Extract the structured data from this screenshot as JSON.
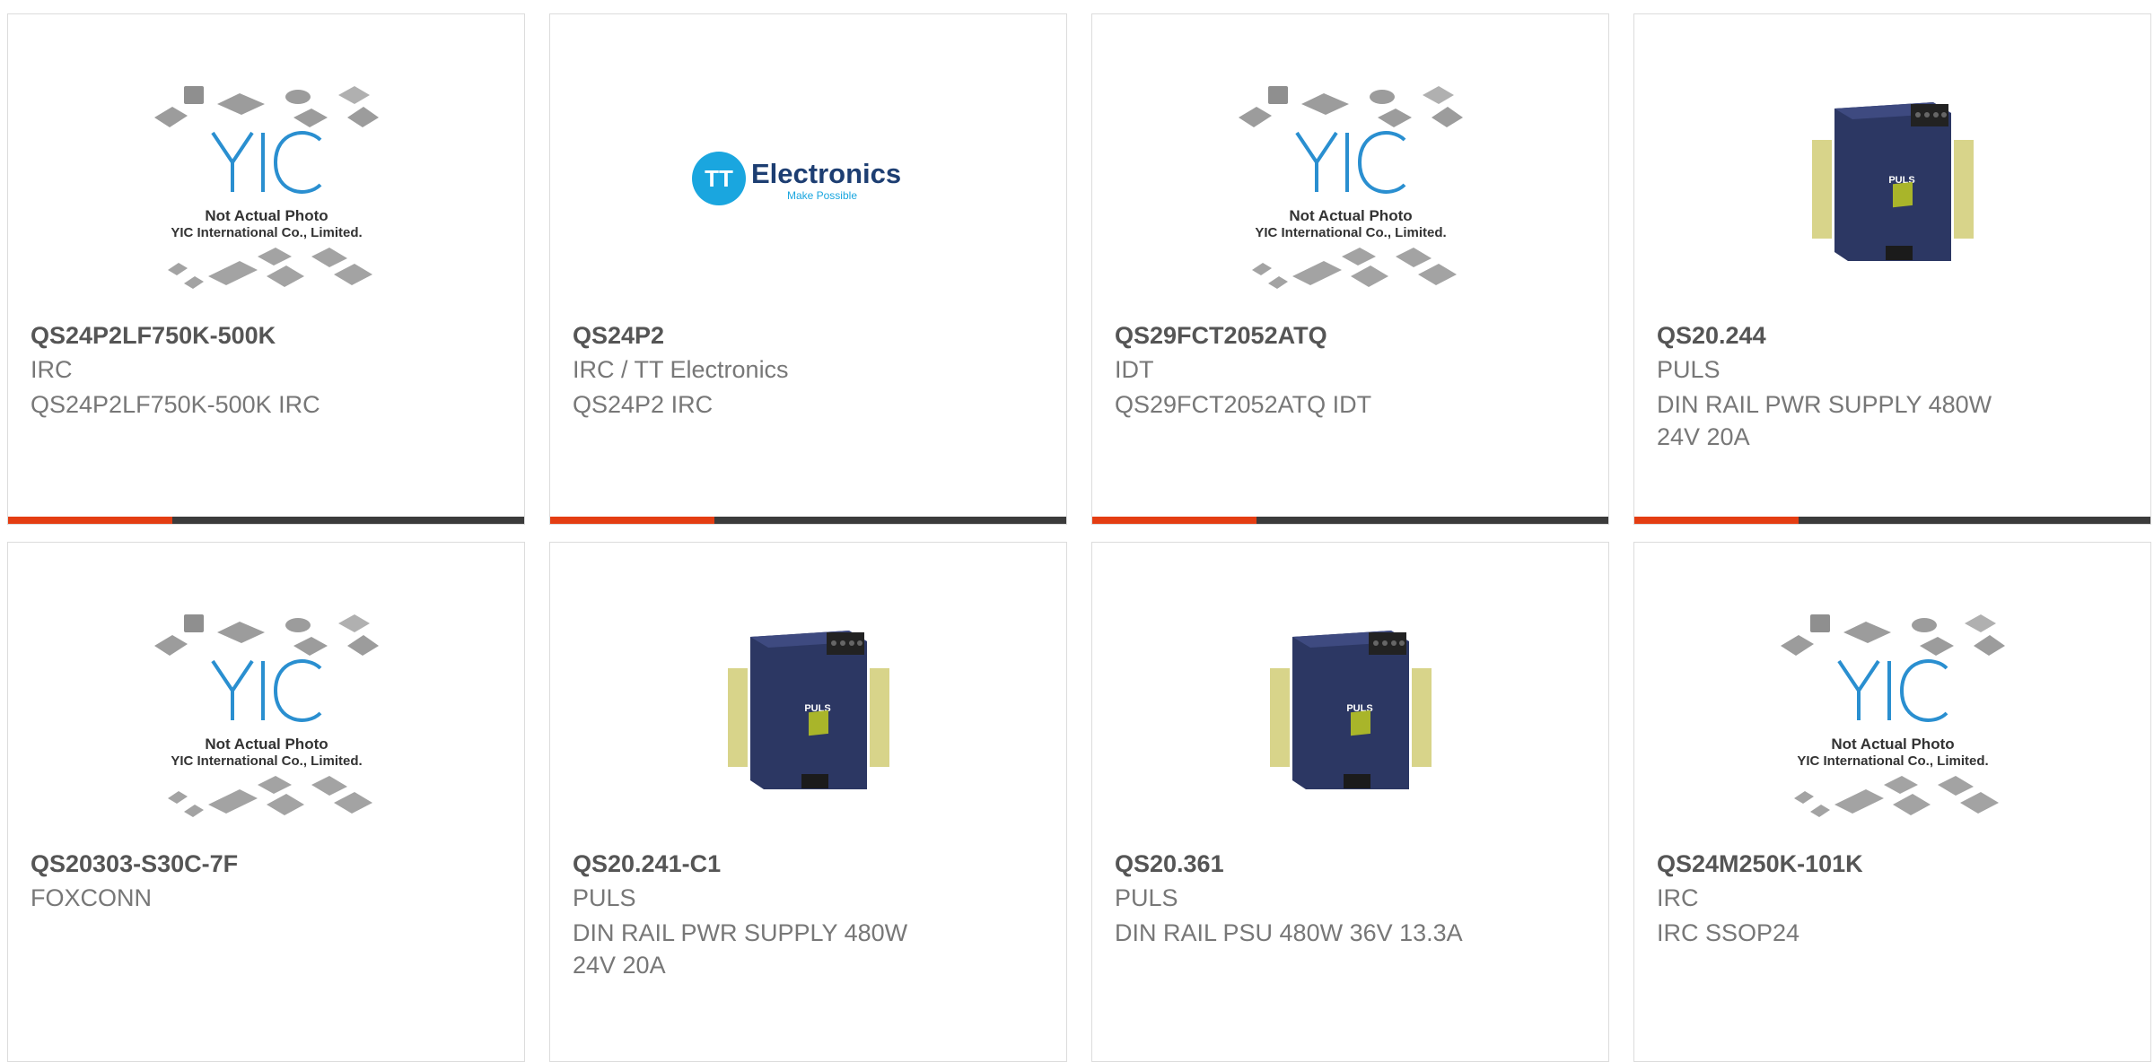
{
  "products": [
    {
      "part": "QS24P2LF750K-500K",
      "manufacturer": "IRC",
      "description": "QS24P2LF750K-500K IRC",
      "image": "yic-placeholder",
      "placeholder_line1": "Not Actual Photo",
      "placeholder_line2": "YIC International Co., Limited."
    },
    {
      "part": "QS24P2",
      "manufacturer": "IRC / TT Electronics",
      "description": "QS24P2 IRC",
      "image": "tt-electronics-logo",
      "logo_text": "Electronics",
      "logo_tagline": "Make Possible",
      "logo_mark": "TT"
    },
    {
      "part": "QS29FCT2052ATQ",
      "manufacturer": "IDT",
      "description": "QS29FCT2052ATQ IDT",
      "image": "yic-placeholder",
      "placeholder_line1": "Not Actual Photo",
      "placeholder_line2": "YIC International Co., Limited."
    },
    {
      "part": "QS20.244",
      "manufacturer": "PULS",
      "description": "DIN RAIL PWR SUPPLY 480W 24V 20A",
      "image": "puls-power-supply",
      "device_brand": "PULS"
    },
    {
      "part": "QS20303-S30C-7F",
      "manufacturer": "FOXCONN",
      "description": "",
      "image": "yic-placeholder",
      "placeholder_line1": "Not Actual Photo",
      "placeholder_line2": "YIC International Co., Limited."
    },
    {
      "part": "QS20.241-C1",
      "manufacturer": "PULS",
      "description": "DIN RAIL PWR SUPPLY 480W 24V 20A",
      "image": "puls-power-supply",
      "device_brand": "PULS"
    },
    {
      "part": "QS20.361",
      "manufacturer": "PULS",
      "description": "DIN RAIL PSU 480W 36V 13.3A",
      "image": "puls-power-supply",
      "device_brand": "PULS"
    },
    {
      "part": "QS24M250K-101K",
      "manufacturer": "IRC",
      "description": "IRC SSOP24",
      "image": "yic-placeholder",
      "placeholder_line1": "Not Actual Photo",
      "placeholder_line2": "YIC International Co., Limited."
    }
  ],
  "colors": {
    "accent": "#e43d12",
    "bar": "#3b3b3b",
    "part_text": "#555555",
    "meta_text": "#777777",
    "tt_blue": "#1aa6df",
    "yic_blue": "#2a8fd0",
    "puls_body": "#2c3763"
  }
}
